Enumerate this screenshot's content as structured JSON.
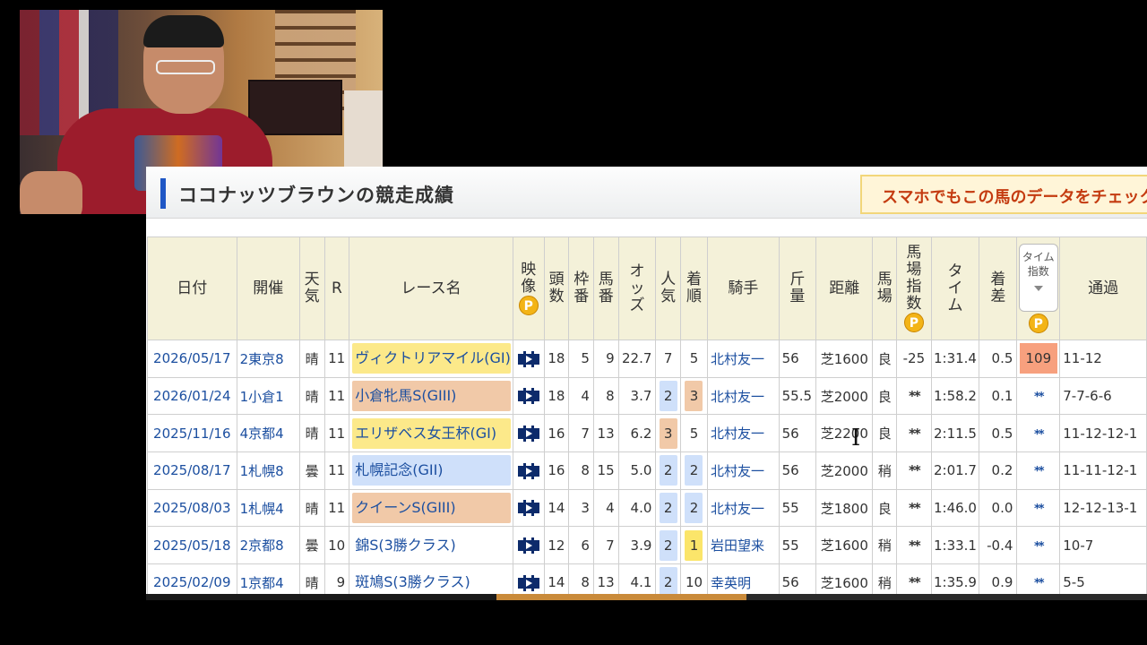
{
  "header": {
    "title": "ココナッツブラウンの競走成績",
    "banner": "スマホでもこの馬のデータをチェック"
  },
  "columns": {
    "date": "日付",
    "venue": "開催",
    "weather": "天気",
    "race_no": "R",
    "race_name": "レース名",
    "video": "映像",
    "field_size": "頭数",
    "gate": "枠番",
    "horse_no": "馬番",
    "odds": "オッズ",
    "popularity": "人気",
    "finish": "着順",
    "jockey": "騎手",
    "weight": "斤量",
    "distance": "距離",
    "track": "馬場",
    "track_index": "馬場指数",
    "time": "タイム",
    "margin": "着差",
    "time_index_line1": "タイム",
    "time_index_line2": "指数",
    "passing": "通過",
    "premium_badge": "P"
  },
  "rows": [
    {
      "date": "2026/05/17",
      "venue": "2東京8",
      "weather": "晴",
      "race_no": "11",
      "race_name": "ヴィクトリアマイル(GI)",
      "race_color": "#fce98a",
      "field_size": "18",
      "gate": "5",
      "horse_no": "9",
      "odds": "22.7",
      "popularity": "7",
      "finish": "5",
      "jockey": "北村友一",
      "weight": "56",
      "distance": "芝1600",
      "track": "良",
      "track_index": "-25",
      "time": "1:31.4",
      "margin": "0.5",
      "time_index": "109",
      "passing": "11-12"
    },
    {
      "date": "2026/01/24",
      "venue": "1小倉1",
      "weather": "晴",
      "race_no": "11",
      "race_name": "小倉牝馬S(GIII)",
      "race_color": "#f1c9a8",
      "field_size": "18",
      "gate": "4",
      "horse_no": "8",
      "odds": "3.7",
      "popularity": "2",
      "finish": "3",
      "jockey": "北村友一",
      "weight": "55.5",
      "distance": "芝2000",
      "track": "良",
      "track_index": "**",
      "time": "1:58.2",
      "margin": "0.1",
      "time_index": "**",
      "passing": "7-7-6-6"
    },
    {
      "date": "2025/11/16",
      "venue": "4京都4",
      "weather": "晴",
      "race_no": "11",
      "race_name": "エリザベス女王杯(GI)",
      "race_color": "#fce98a",
      "field_size": "16",
      "gate": "7",
      "horse_no": "13",
      "odds": "6.2",
      "popularity": "3",
      "finish": "5",
      "jockey": "北村友一",
      "weight": "56",
      "distance": "芝2200",
      "track": "良",
      "track_index": "**",
      "time": "2:11.5",
      "margin": "0.5",
      "time_index": "**",
      "passing": "11-12-12-1"
    },
    {
      "date": "2025/08/17",
      "venue": "1札幌8",
      "weather": "曇",
      "race_no": "11",
      "race_name": "札幌記念(GII)",
      "race_color": "#cfe0fa",
      "field_size": "16",
      "gate": "8",
      "horse_no": "15",
      "odds": "5.0",
      "popularity": "2",
      "finish": "2",
      "jockey": "北村友一",
      "weight": "56",
      "distance": "芝2000",
      "track": "稍",
      "track_index": "**",
      "time": "2:01.7",
      "margin": "0.2",
      "time_index": "**",
      "passing": "11-11-12-1"
    },
    {
      "date": "2025/08/03",
      "venue": "1札幌4",
      "weather": "晴",
      "race_no": "11",
      "race_name": "クイーンS(GIII)",
      "race_color": "#f1c9a8",
      "field_size": "14",
      "gate": "3",
      "horse_no": "4",
      "odds": "4.0",
      "popularity": "2",
      "finish": "2",
      "jockey": "北村友一",
      "weight": "55",
      "distance": "芝1800",
      "track": "良",
      "track_index": "**",
      "time": "1:46.0",
      "margin": "0.0",
      "time_index": "**",
      "passing": "12-12-13-1"
    },
    {
      "date": "2025/05/18",
      "venue": "2京都8",
      "weather": "曇",
      "race_no": "10",
      "race_name": "錦S(3勝クラス)",
      "race_color": "",
      "field_size": "12",
      "gate": "6",
      "horse_no": "7",
      "odds": "3.9",
      "popularity": "2",
      "finish": "1",
      "jockey": "岩田望来",
      "weight": "55",
      "distance": "芝1600",
      "track": "稍",
      "track_index": "**",
      "time": "1:33.1",
      "margin": "-0.4",
      "time_index": "**",
      "passing": "10-7"
    },
    {
      "date": "2025/02/09",
      "venue": "1京都4",
      "weather": "晴",
      "race_no": "9",
      "race_name": "斑鳩S(3勝クラス)",
      "race_color": "",
      "field_size": "14",
      "gate": "8",
      "horse_no": "13",
      "odds": "4.1",
      "popularity": "2",
      "finish": "10",
      "jockey": "幸英明",
      "weight": "56",
      "distance": "芝1600",
      "track": "稍",
      "track_index": "**",
      "time": "1:35.9",
      "margin": "0.9",
      "time_index": "**",
      "passing": "5-5"
    }
  ],
  "colors": {
    "header_bg": "#f4f1d9",
    "link": "#1c4fa0",
    "popularity_chip": "#cfe0fa",
    "finish_first": "#fbe56a",
    "finish_third": "#f1c9a8",
    "time_index_highlight": "#f7a07e"
  }
}
